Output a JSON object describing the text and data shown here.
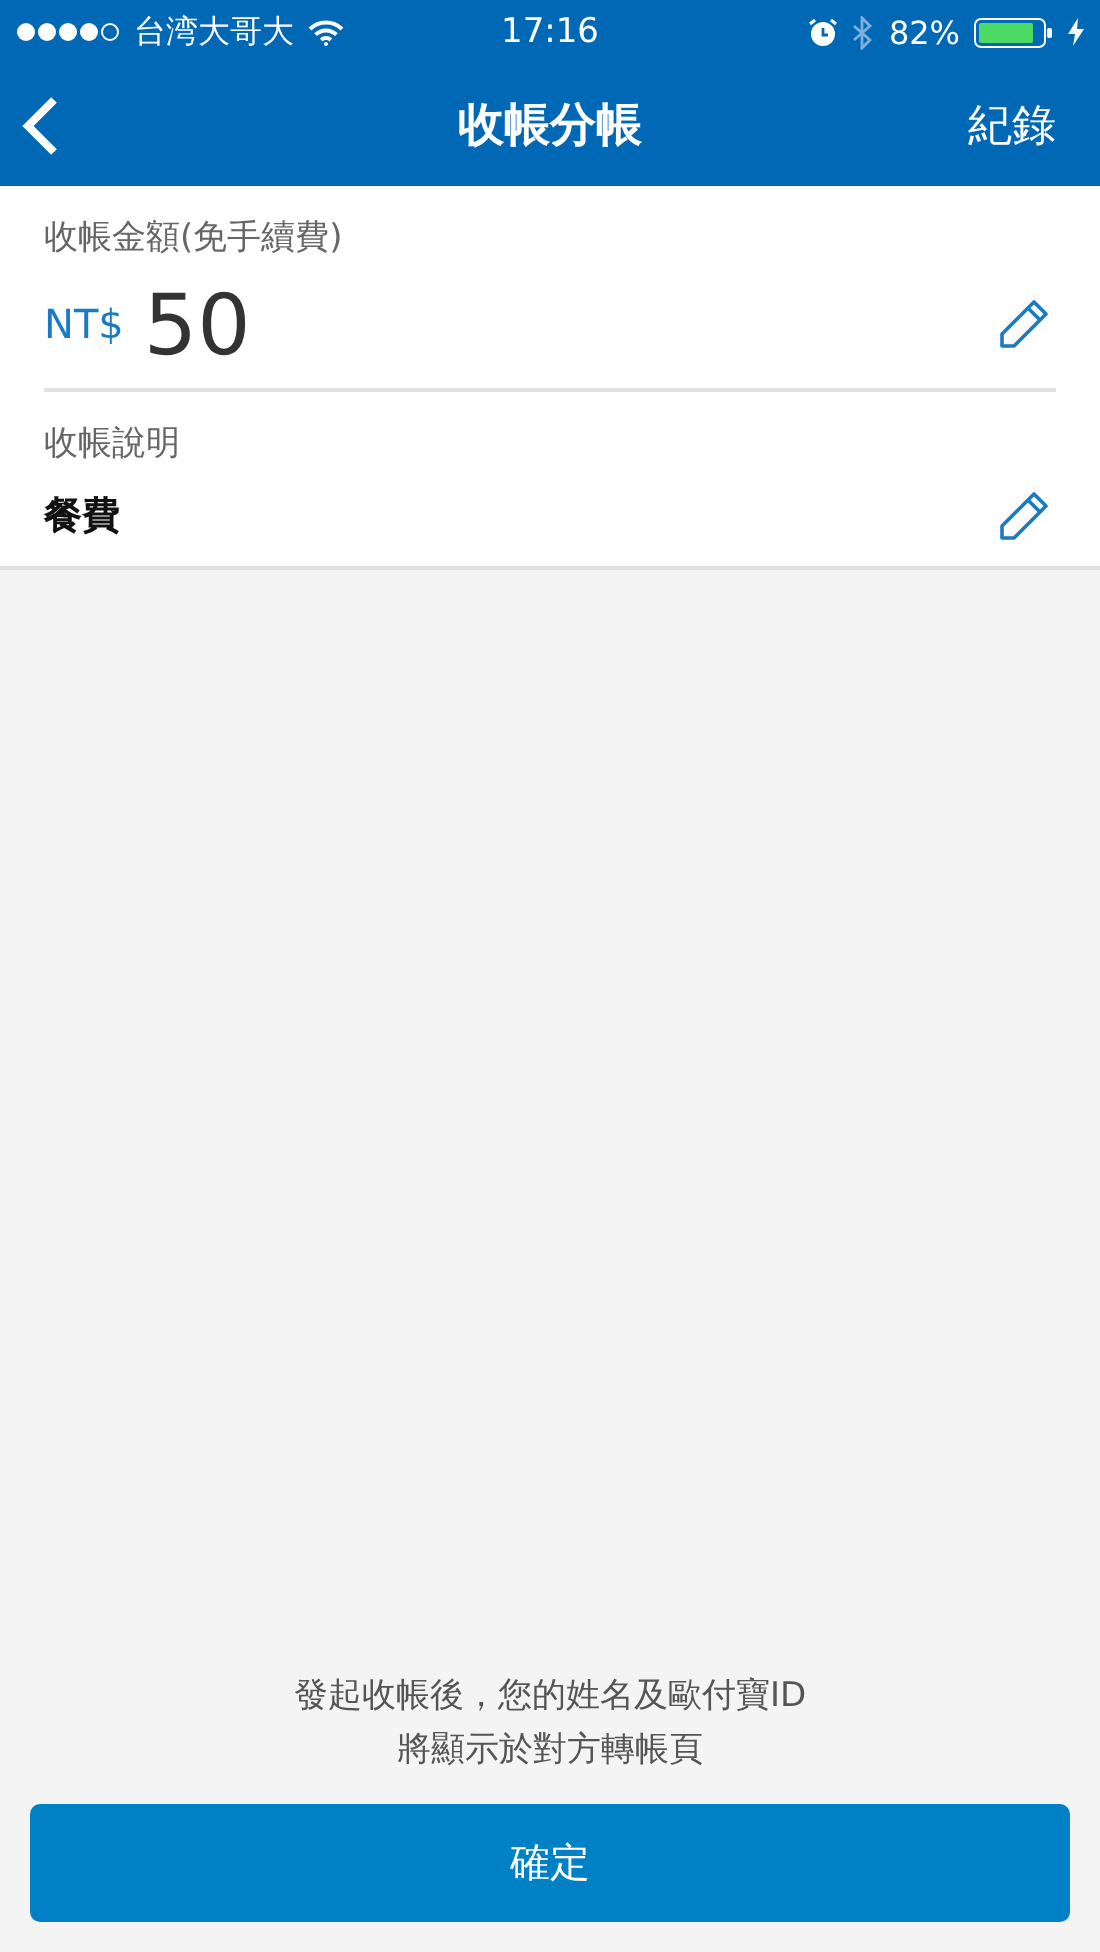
{
  "status_bar": {
    "carrier": "台湾大哥大",
    "time": "17:16",
    "battery": "82%"
  },
  "nav_bar": {
    "title": "收帳分帳",
    "action": "紀錄"
  },
  "amount": {
    "label": "收帳金額(免手續費)",
    "currency": "NT$",
    "value": "50"
  },
  "description": {
    "label": "收帳說明",
    "value": "餐費"
  },
  "notice": [
    "發起收帳後，您的姓名及歐付寶ID",
    "將顯示於對方轉帳頁"
  ],
  "confirm_button": "確定"
}
